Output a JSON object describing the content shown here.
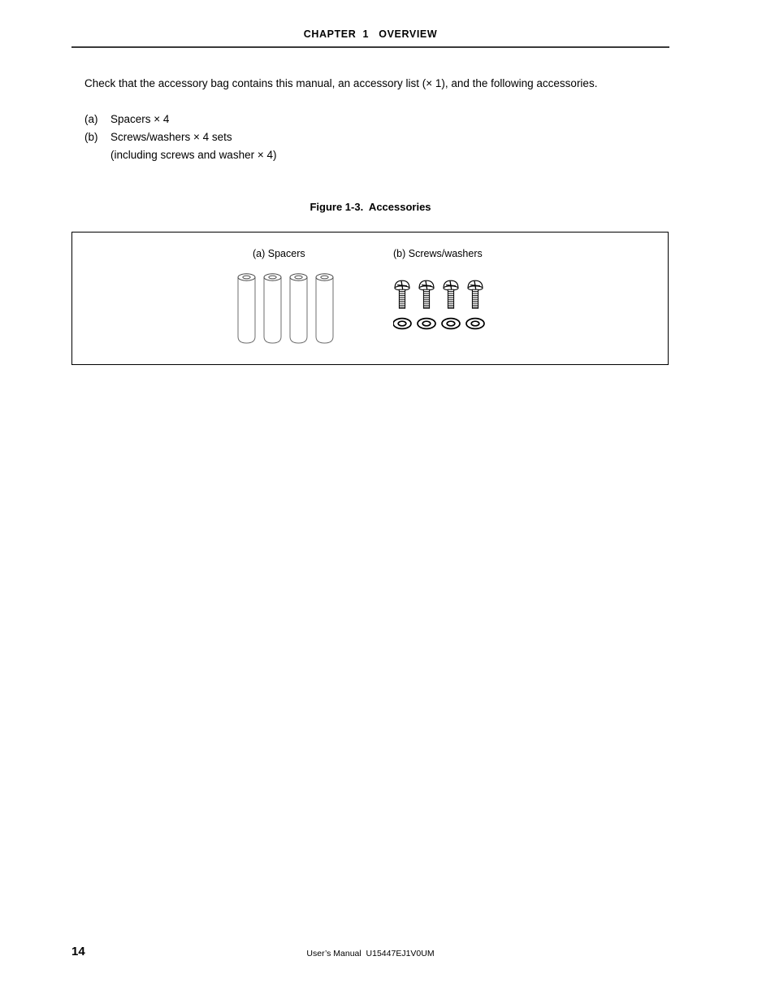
{
  "header": {
    "chapter_title": "CHAPTER  1   OVERVIEW"
  },
  "body": {
    "intro_paragraph": "Check that the accessory bag contains this manual, an accessory list (× 1), and the following accessories.",
    "list": [
      {
        "marker": "(a)",
        "text": "Spacers × 4",
        "continuation": ""
      },
      {
        "marker": "(b)",
        "text": "Screws/washers × 4 sets",
        "continuation": "(including screws and washer × 4)"
      }
    ]
  },
  "figure": {
    "caption": "Figure 1-3.  Accessories",
    "label_spacers": "(a) Spacers",
    "label_screws": "(b) Screws/washers",
    "spacer_count": 4,
    "screw_count": 4,
    "washer_count": 4,
    "line_color": "#000000"
  },
  "footer": {
    "page_number": "14",
    "manual_line": "User’s Manual  U15447EJ1V0UM"
  }
}
